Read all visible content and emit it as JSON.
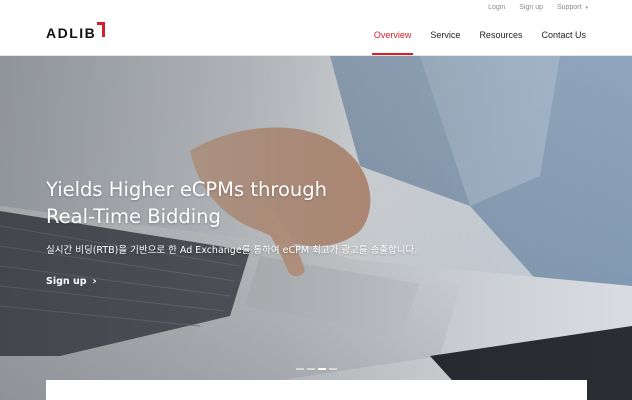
{
  "utility": {
    "login": "Login",
    "signup": "Sign up",
    "support": "Support",
    "support_caret": "▾"
  },
  "brand": {
    "logo_text": "ADLIB",
    "accent_color": "#d62027"
  },
  "nav": {
    "items": [
      {
        "label": "Overview",
        "active": true
      },
      {
        "label": "Service",
        "active": false
      },
      {
        "label": "Resources",
        "active": false
      },
      {
        "label": "Contact Us",
        "active": false
      }
    ]
  },
  "hero": {
    "title_line1": "Yields Higher eCPMs through",
    "title_line2": "Real-Time Bidding",
    "subtitle": "실시간 비딩(RTB)을 기반으로 한 Ad Exchange를 통하여 eCPM 최고가 광고를 송출합니다.",
    "cta_label": "Sign up",
    "cta_icon": "chevron-right-icon",
    "cta_glyph": "›",
    "slides_total": 4,
    "slide_active": 3
  }
}
